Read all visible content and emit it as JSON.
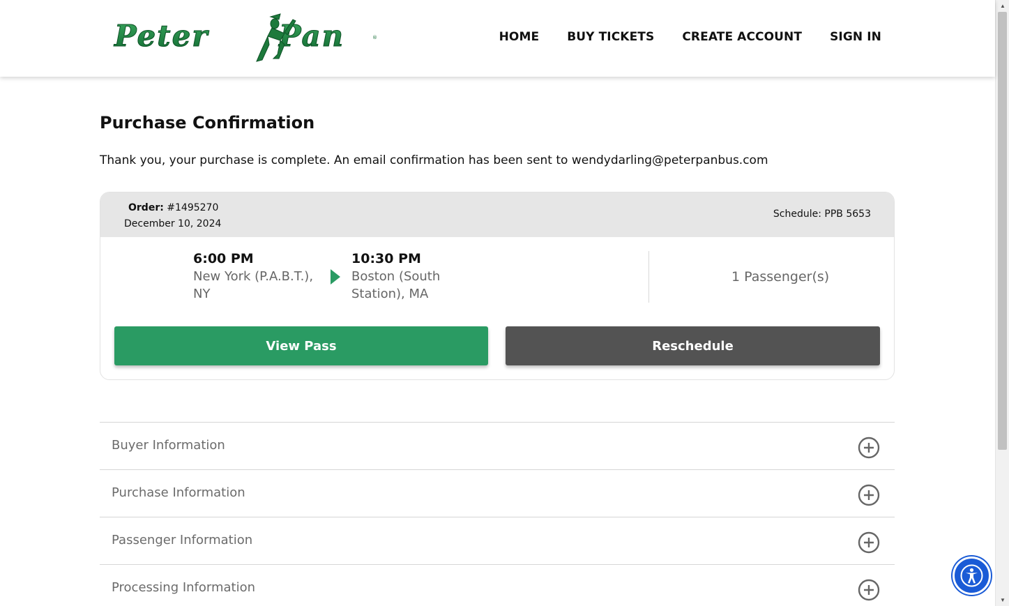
{
  "header": {
    "logo_alt": "Peter Pan",
    "nav": [
      {
        "label": "HOME"
      },
      {
        "label": "BUY TICKETS"
      },
      {
        "label": "CREATE ACCOUNT"
      },
      {
        "label": "SIGN IN"
      }
    ]
  },
  "page": {
    "title": "Purchase Confirmation",
    "thanks": "Thank you, your purchase is complete. An email confirmation has been sent to wendydarling@peterpanbus.com"
  },
  "order": {
    "order_label": "Order:",
    "order_number": "#1495270",
    "date": "December 10, 2024",
    "schedule": "Schedule: PPB 5653",
    "departure": {
      "time": "6:00 PM",
      "place": "New York (P.A.B.T.), NY"
    },
    "arrival": {
      "time": "10:30 PM",
      "place": "Boston (South Station), MA"
    },
    "passengers": "1 Passenger(s)",
    "view_pass_label": "View Pass",
    "reschedule_label": "Reschedule"
  },
  "accordion": [
    {
      "label": "Buyer Information"
    },
    {
      "label": "Purchase Information"
    },
    {
      "label": "Passenger Information"
    },
    {
      "label": "Processing Information"
    }
  ],
  "colors": {
    "brand_green": "#2a9b63",
    "dark_button": "#535353",
    "accessibility_blue": "#1a5bd6"
  }
}
